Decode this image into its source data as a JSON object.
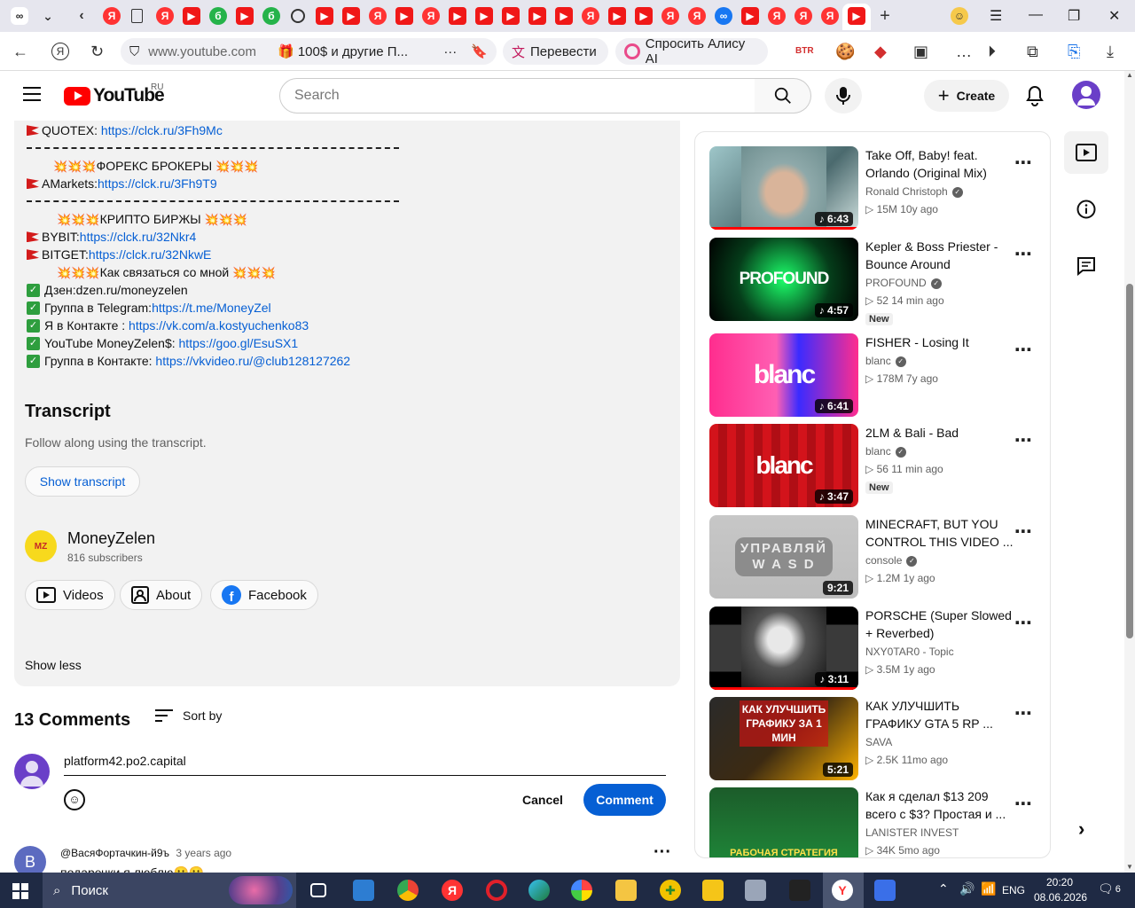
{
  "browser": {
    "address": "www.youtube.com",
    "tab_title": "🎁 100$ и другие П...",
    "translate": "Перевести",
    "alice": "Спросить Алису AI",
    "btr": "BTR"
  },
  "header": {
    "logo": "YouTube",
    "region": "RU",
    "search_placeholder": "Search",
    "create": "Create"
  },
  "description": {
    "lines": {
      "quotex_label": "QUOTEX: ",
      "quotex_link": "https://clck.ru/3Fh9Mc",
      "forex_heading": "ФОРЕКС БРОКЕРЫ",
      "amarkets_label": "AMarkets:",
      "amarkets_link": "https://clck.ru/3Fh9T9",
      "crypto_heading": "КРИПТО БИРЖЫ",
      "bybit_label": "BYBIT:",
      "bybit_link": "https://clck.ru/32Nkr4",
      "bitget_label": "BITGET:",
      "bitget_link": "https://clck.ru/32NkwE",
      "contact_heading": "Как связаться со мной",
      "dzen": "Дзен:dzen.ru/moneyzelen",
      "tg_label": "Группа в Telegram:",
      "tg_link": "https://t.me/MoneyZel",
      "vk_label": "Я в Контакте  : ",
      "vk_link": "https://vk.com/a.kostyuchenko83",
      "yt_label": "YouTube MoneyZelen$: ",
      "yt_link": "https://goo.gl/EsuSX1",
      "vkgroup_label": "Группа в Контакте: ",
      "vkgroup_link": "https://vkvideo.ru/@club128127262"
    },
    "transcript_title": "Transcript",
    "transcript_sub": "Follow along using the transcript.",
    "show_transcript": "Show transcript",
    "channel_name": "MoneyZelen",
    "channel_subs": "816 subscribers",
    "chip_videos": "Videos",
    "chip_about": "About",
    "chip_facebook": "Facebook",
    "show_less": "Show less"
  },
  "comments": {
    "count": "13 Comments",
    "sort": "Sort by",
    "input_value": "platform42.po2.capital",
    "cancel": "Cancel",
    "comment": "Comment",
    "first_author": "@ВасяФортачкин-й9ъ",
    "first_time": "3 years ago",
    "first_avatar_letter": "В",
    "first_text": "подаречки я люблю🙂🙂"
  },
  "related": [
    {
      "title": "Take Off, Baby! feat. Orlando (Original Mix)",
      "channel": "Ronald Christoph",
      "views": "15M",
      "age": "10y ago",
      "duration": "6:43",
      "music": true,
      "verified": true,
      "progress": 1.0,
      "new": ""
    },
    {
      "title": "Kepler & Boss Priester - Bounce Around",
      "channel": "PROFOUND",
      "views": "52",
      "age": "14 min ago",
      "duration": "4:57",
      "music": true,
      "verified": true,
      "progress": 0,
      "new": "New",
      "thumb_text": "PROFOUND"
    },
    {
      "title": "FISHER - Losing It",
      "channel": "blanc",
      "views": "178M",
      "age": "7y ago",
      "duration": "6:41",
      "music": true,
      "verified": true,
      "progress": 0,
      "new": "",
      "thumb_text": "blanc"
    },
    {
      "title": "2LM & Bali - Bad",
      "channel": "blanc",
      "views": "56",
      "age": "11 min ago",
      "duration": "3:47",
      "music": true,
      "verified": true,
      "progress": 0,
      "new": "New",
      "thumb_text": "blanc"
    },
    {
      "title": "MINECRAFT, BUT YOU CONTROL THIS VIDEO ...",
      "channel": "console",
      "views": "1.2M",
      "age": "1y ago",
      "duration": "9:21",
      "music": false,
      "verified": true,
      "progress": 0,
      "new": "",
      "thumb_text": "УПРАВЛЯЙ W A S D"
    },
    {
      "title": "PORSCHE (Super Slowed + Reverbed)",
      "channel": "NXY0TAR0 - Topic",
      "views": "3.5M",
      "age": "1y ago",
      "duration": "3:11",
      "music": true,
      "verified": false,
      "progress": 1.0,
      "new": ""
    },
    {
      "title": "КАК УЛУЧШИТЬ ГРАФИКУ GTA 5 RP ...",
      "channel": "SAVA",
      "views": "2.5K",
      "age": "11mo ago",
      "duration": "5:21",
      "music": false,
      "verified": false,
      "progress": 0,
      "new": "",
      "thumb_text": "КАК УЛУЧШИТЬ ГРАФИКУ ЗА 1 МИН"
    },
    {
      "title": "Как я сделал $13 209 всего с $3? Простая и ...",
      "channel": "LANISTER INVEST",
      "views": "34K",
      "age": "5mo ago",
      "duration": "",
      "music": false,
      "verified": false,
      "progress": 0,
      "new": "",
      "thumb_text": "РАБОЧАЯ СТРАТЕГИЯ"
    }
  ],
  "taskbar": {
    "search": "Поиск",
    "lang": "ENG",
    "time": "20:20",
    "date": "08.06.2026",
    "notif": "6"
  },
  "colors": {
    "accent": "#065fd4",
    "brand": "#ff0000",
    "comment_btn": "#065fd4"
  }
}
